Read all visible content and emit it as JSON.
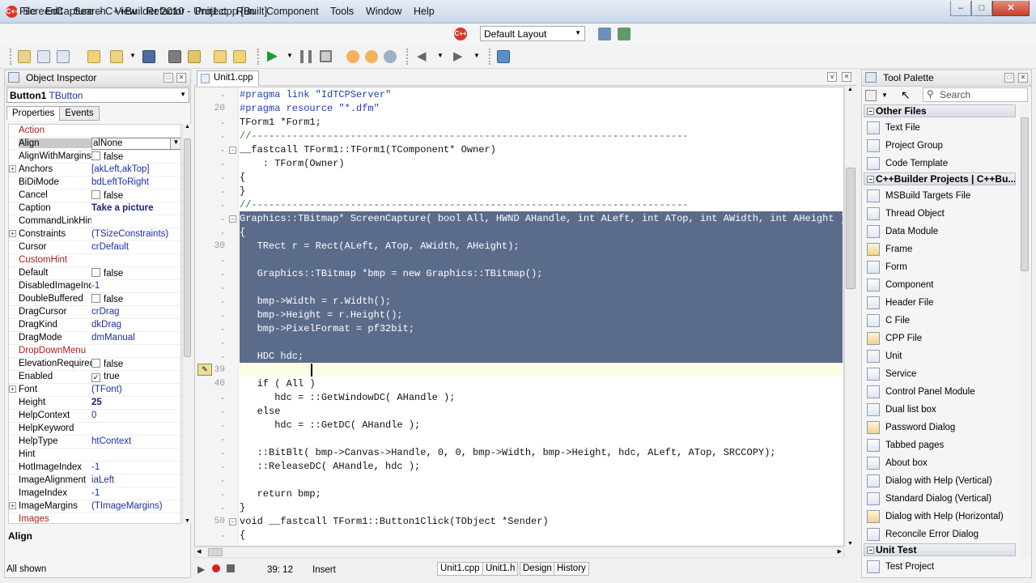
{
  "window": {
    "title": "ScreenCapture – C++Builder 2010 - Unit1.cpp [Built]",
    "app_icon": "C++"
  },
  "menu": [
    "File",
    "Edit",
    "Search",
    "View",
    "Refactor",
    "Project",
    "Run",
    "Component",
    "Tools",
    "Window",
    "Help"
  ],
  "layout_select": "Default Layout",
  "object_inspector": {
    "title": "Object Inspector",
    "component": "Button1",
    "component_type": "TButton",
    "tabs": [
      "Properties",
      "Events"
    ],
    "selected_property": "Align",
    "status": "All shown",
    "rows": [
      {
        "name": "Action",
        "value": "",
        "style": "red"
      },
      {
        "name": "Align",
        "value": "alNone",
        "selected": true
      },
      {
        "name": "AlignWithMargins",
        "value": "false",
        "check": true
      },
      {
        "name": "Anchors",
        "value": "[akLeft,akTop]",
        "expand": true,
        "style": "blue"
      },
      {
        "name": "BiDiMode",
        "value": "bdLeftToRight",
        "style": "blue"
      },
      {
        "name": "Cancel",
        "value": "false",
        "check": true
      },
      {
        "name": "Caption",
        "value": "Take a picture",
        "bold": true
      },
      {
        "name": "CommandLinkHint",
        "value": ""
      },
      {
        "name": "Constraints",
        "value": "(TSizeConstraints)",
        "expand": true,
        "style": "blue"
      },
      {
        "name": "Cursor",
        "value": "crDefault",
        "style": "blue"
      },
      {
        "name": "CustomHint",
        "value": "",
        "style": "red"
      },
      {
        "name": "Default",
        "value": "false",
        "check": true
      },
      {
        "name": "DisabledImageInd",
        "value": "-1",
        "style": "blue"
      },
      {
        "name": "DoubleBuffered",
        "value": "false",
        "check": true
      },
      {
        "name": "DragCursor",
        "value": "crDrag",
        "style": "blue"
      },
      {
        "name": "DragKind",
        "value": "dkDrag",
        "style": "blue"
      },
      {
        "name": "DragMode",
        "value": "dmManual",
        "style": "blue"
      },
      {
        "name": "DropDownMenu",
        "value": "",
        "style": "red"
      },
      {
        "name": "ElevationRequired",
        "value": "false",
        "check": true
      },
      {
        "name": "Enabled",
        "value": "true",
        "check": true,
        "checked": true
      },
      {
        "name": "Font",
        "value": "(TFont)",
        "expand": true,
        "style": "blue"
      },
      {
        "name": "Height",
        "value": "25",
        "bold": true
      },
      {
        "name": "HelpContext",
        "value": "0",
        "style": "blue"
      },
      {
        "name": "HelpKeyword",
        "value": ""
      },
      {
        "name": "HelpType",
        "value": "htContext",
        "style": "blue"
      },
      {
        "name": "Hint",
        "value": ""
      },
      {
        "name": "HotImageIndex",
        "value": "-1",
        "style": "blue"
      },
      {
        "name": "ImageAlignment",
        "value": "iaLeft",
        "style": "blue"
      },
      {
        "name": "ImageIndex",
        "value": "-1",
        "style": "blue"
      },
      {
        "name": "ImageMargins",
        "value": "(TImageMargins)",
        "expand": true,
        "style": "blue"
      },
      {
        "name": "Images",
        "value": "",
        "style": "red"
      }
    ]
  },
  "editor": {
    "tab": "Unit1.cpp",
    "bookmark": "✎",
    "line_numbers": [
      {
        "n": "20",
        "row": 1
      },
      {
        "n": "30",
        "row": 11
      },
      {
        "n": "39",
        "row": 20
      },
      {
        "n": "40",
        "row": 21
      },
      {
        "n": "50",
        "row": 31
      }
    ],
    "lines": [
      "#pragma link \"IdTCPServer\"",
      "#pragma resource \"*.dfm\"",
      "TForm1 *Form1;",
      "//---------------------------------------------------------------------------",
      "__fastcall TForm1::TForm1(TComponent* Owner)",
      "    : TForm(Owner)",
      "{",
      "}",
      "//---------------------------------------------------------------------------",
      "Graphics::TBitmap* ScreenCapture( bool All, HWND AHandle, int ALeft, int ATop, int AWidth, int AHeight )",
      "{",
      "   TRect r = Rect(ALeft, ATop, AWidth, AHeight);",
      "",
      "   Graphics::TBitmap *bmp = new Graphics::TBitmap();",
      "",
      "   bmp->Width = r.Width();",
      "   bmp->Height = r.Height();",
      "   bmp->PixelFormat = pf32bit;",
      "",
      "   HDC hdc;",
      "",
      "   if ( All )",
      "      hdc = ::GetWindowDC( AHandle );",
      "   else",
      "      hdc = ::GetDC( AHandle );",
      "",
      "   ::BitBlt( bmp->Canvas->Handle, 0, 0, bmp->Width, bmp->Height, hdc, ALeft, ATop, SRCCOPY);",
      "   ::ReleaseDC( AHandle, hdc );",
      "",
      "   return bmp;",
      "}",
      "void __fastcall TForm1::Button1Click(TObject *Sender)",
      "{"
    ]
  },
  "status": {
    "position": "39: 12",
    "mode": "Insert"
  },
  "bottom_tabs": [
    "Unit1.cpp",
    "Unit1.h",
    "Design",
    "History"
  ],
  "tool_palette": {
    "title": "Tool Palette",
    "search_placeholder": "Search",
    "categories": [
      {
        "name": "Other Files",
        "items": [
          "Text File",
          "Project Group",
          "Code Template"
        ]
      },
      {
        "name": "C++Builder Projects | C++Bu...",
        "items": [
          "MSBuild Targets File",
          "Thread Object",
          "Data Module",
          "Frame",
          "Form",
          "Component",
          "Header File",
          "C File",
          "CPP File",
          "Unit",
          "Service",
          "Control Panel Module",
          "Dual list box",
          "Password Dialog",
          "Tabbed pages",
          "About box",
          "Dialog with Help (Vertical)",
          "Standard Dialog (Vertical)",
          "Dialog with Help (Horizontal)",
          "Reconcile Error Dialog"
        ]
      },
      {
        "name": "Unit Test",
        "items": [
          "Test Project"
        ]
      }
    ]
  },
  "colors": {
    "selection": "#5b6b8a",
    "accent": "#d9362c"
  }
}
